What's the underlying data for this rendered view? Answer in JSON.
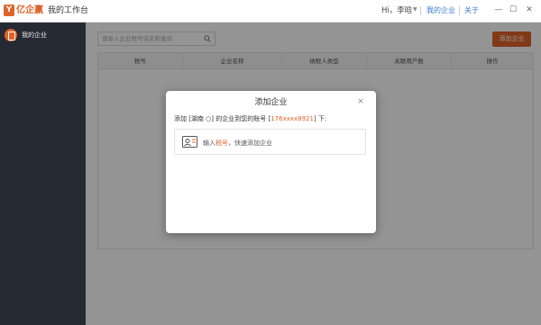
{
  "titlebar": {
    "logo_text": "亿企赢",
    "app_title": "我的工作台",
    "greeting": "Hi，李晗",
    "link_company": "我的企业",
    "link_about": "关于",
    "min_glyph": "—",
    "max_glyph": "☐",
    "close_glyph": "✕"
  },
  "sidebar": {
    "items": [
      {
        "label": "我的企业"
      }
    ]
  },
  "main": {
    "search_placeholder": "请输入企业税号或名称查询",
    "add_button": "添加企业",
    "columns": [
      "税号",
      "企业名称",
      "纳税人类型",
      "关联用户数",
      "操作"
    ]
  },
  "modal": {
    "title": "添加企业",
    "close_glyph": "×",
    "line_prefix": "添加 [湖南 ○] 的企业到您的账号 [",
    "account": "176xxxx8921",
    "line_suffix": "] 下:",
    "option_prefix": "输入",
    "option_keyword": "税号",
    "option_suffix": "，快速添加企业"
  },
  "colors": {
    "accent": "#e0632a",
    "link": "#3a7bd5",
    "sidebar_bg": "#262a35"
  }
}
